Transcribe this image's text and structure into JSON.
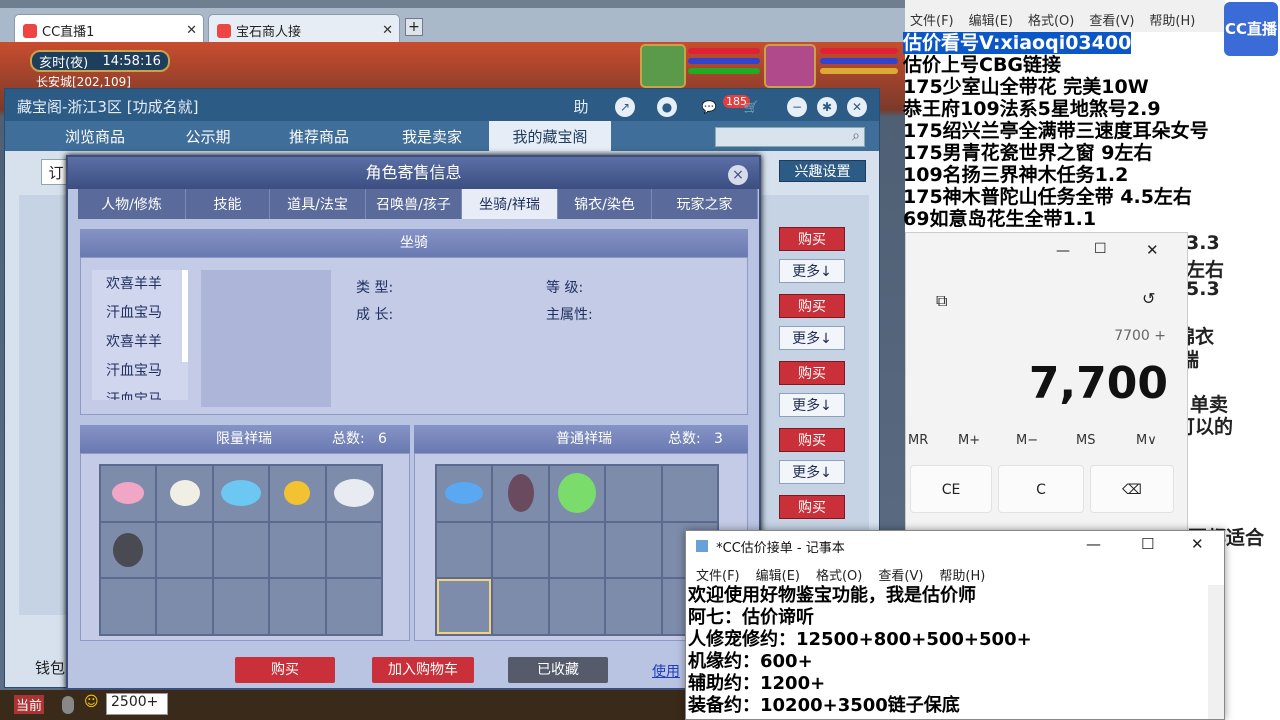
{
  "browser": {
    "tabs": [
      {
        "label": "CC直播1"
      },
      {
        "label": "宝石商人接"
      }
    ],
    "new_tab": "+"
  },
  "game": {
    "time_label": "亥时(夜)",
    "clock": "14:58:16",
    "location": "长安城[202,109]",
    "bottom_left": "当前",
    "bottom_input": "2500+"
  },
  "cbg": {
    "title": "藏宝阁-浙江3区 [功成名就]",
    "toolbar": {
      "help": "助",
      "badge": "185"
    },
    "nav": [
      "浏览商品",
      "公示期",
      "推荐商品",
      "我是卖家",
      "我的藏宝阁"
    ],
    "active_nav": "我的藏宝阁",
    "left_label": "订",
    "wallet_label": "钱包",
    "interest_button": "兴趣设置",
    "buy_label": "购买",
    "more_label": "更多↓"
  },
  "modal": {
    "title": "角色寄售信息",
    "close": "×",
    "tabs": [
      "人物/修炼",
      "技能",
      "道具/法宝",
      "召唤兽/孩子",
      "坐骑/祥瑞",
      "锦衣/染色",
      "玩家之家"
    ],
    "active_tab": "坐骑/祥瑞",
    "mount_section": "坐骑",
    "mounts": [
      "欢喜羊羊",
      "汗血宝马",
      "欢喜羊羊",
      "汗血宝马",
      "汗血宝马"
    ],
    "fields": {
      "type": "类    型:",
      "grade": "等    级:",
      "growth": "成    长:",
      "main_attr": "主属性:"
    },
    "limited": {
      "title": "限量祥瑞",
      "total_label": "总数:",
      "total": "6"
    },
    "normal": {
      "title": "普通祥瑞",
      "total_label": "总数:",
      "total": "3"
    },
    "buttons": {
      "buy": "购买",
      "add_cart": "加入购物车",
      "favorited": "已收藏",
      "use": "使用"
    }
  },
  "notepad_bg": {
    "menu": [
      "文件(F)",
      "编辑(E)",
      "格式(O)",
      "查看(V)",
      "帮助(H)"
    ],
    "lines": [
      "估价看号V:xiaoqi03400",
      "估价上号CBG链接",
      "175少室山全带花  完美10W",
      "恭王府109法系5星地煞号2.9",
      "175绍兴兰亭全满带三速度耳朵女号",
      "175男青花瓷世界之窗  9左右",
      "109名扬三界神木任务1.2",
      "175神木普陀山任务全带 4.5左右",
      "69如意岛花生全带1.1"
    ],
    "behind_calc": [
      "3.3",
      "左右",
      "5.3",
      "锦衣",
      "端",
      "单卖",
      "可以的",
      "要都适合"
    ],
    "logo_text": "CC直播"
  },
  "calculator": {
    "expression": "7700 +",
    "value": "7,700",
    "memory_keys": [
      "MR",
      "M+",
      "M−",
      "MS",
      "M∨"
    ],
    "keys": [
      "CE",
      "C",
      "⌫"
    ]
  },
  "notepad": {
    "title": "*CC估价接单 - 记事本",
    "menu": [
      "文件(F)",
      "编辑(E)",
      "格式(O)",
      "查看(V)",
      "帮助(H)"
    ],
    "lines": [
      "欢迎使用好物鉴宝功能，我是估价师",
      "阿七：估价谛听",
      "人修宠修约：12500+800+500+500+",
      "机缘约：600+",
      "辅助约：1200+",
      "装备约：10200+3500链子保底"
    ]
  }
}
